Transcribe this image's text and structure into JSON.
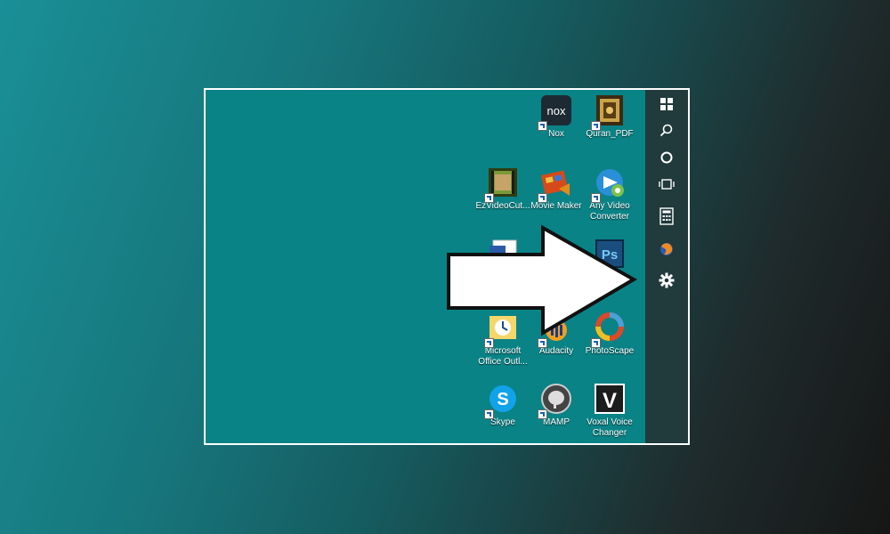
{
  "desktop": {
    "icons": [
      {
        "label": "Nox",
        "icon": "nox-icon"
      },
      {
        "label": "Quran_PDF",
        "icon": "quran-pdf-icon"
      },
      {
        "label": "EzVideoCut...",
        "icon": "ezvideocut-icon"
      },
      {
        "label": "Movie Maker",
        "icon": "movie-maker-icon"
      },
      {
        "label": "Any Video Converter",
        "icon": "any-video-converter-icon"
      },
      {
        "label": "Microsoft Office Outl...",
        "icon": "outlook-icon"
      },
      {
        "label": "Audacity",
        "icon": "audacity-icon"
      },
      {
        "label": "PhotoScape",
        "icon": "photoscape-icon"
      },
      {
        "label": "Skype",
        "icon": "skype-icon"
      },
      {
        "label": "MAMP",
        "icon": "mamp-icon"
      },
      {
        "label": "Voxal Voice Changer",
        "icon": "voxal-voice-changer-icon"
      }
    ]
  },
  "taskbar": {
    "buttons": [
      "windows-start-icon",
      "search-icon",
      "cortana-icon",
      "task-view-icon",
      "calculator-icon",
      "firefox-icon",
      "settings-gear-icon"
    ]
  },
  "colors": {
    "desktop": "#098386",
    "taskbar": "#213a3b",
    "frame_border": "#ffffff",
    "arrow_fill": "#ffffff"
  },
  "nox_text": "nox",
  "ps_text": "Ps",
  "skype_text": "S",
  "voxal_text": "V"
}
